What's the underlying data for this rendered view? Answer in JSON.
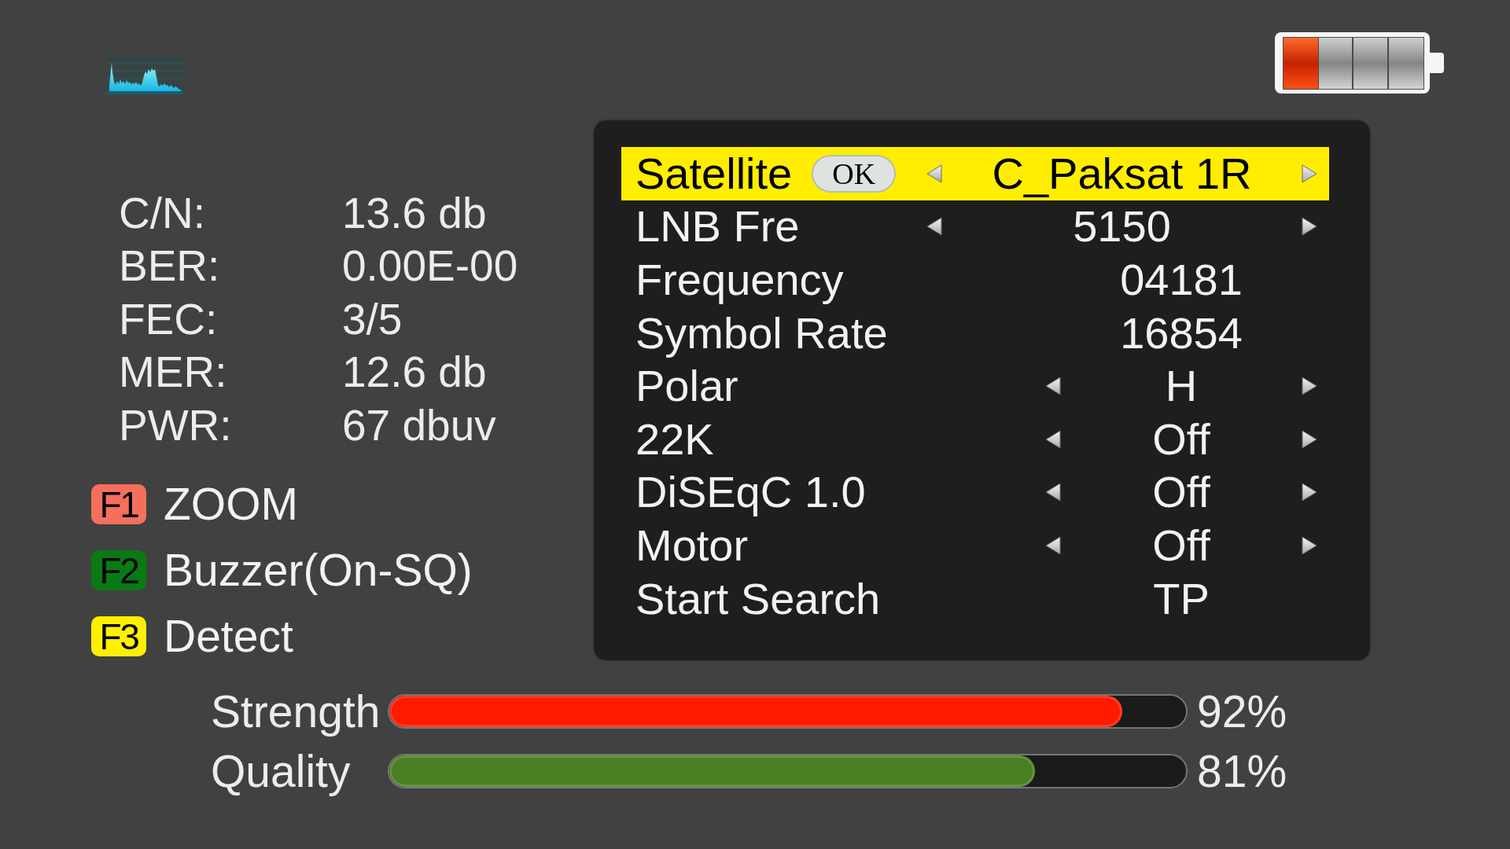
{
  "stats": [
    {
      "label": "C/N:",
      "value": "13.6 db"
    },
    {
      "label": "BER:",
      "value": "0.00E-00"
    },
    {
      "label": "FEC:",
      "value": "3/5"
    },
    {
      "label": "MER:",
      "value": "12.6 db"
    },
    {
      "label": "PWR:",
      "value": "67 dbuv"
    }
  ],
  "function_keys": [
    {
      "key": "F1",
      "label": "ZOOM",
      "color": "#f4705c"
    },
    {
      "key": "F2",
      "label": "Buzzer(On-SQ)",
      "color": "#0a7a14"
    },
    {
      "key": "F3",
      "label": "Detect",
      "color": "#fff000"
    }
  ],
  "menu": {
    "rows": [
      {
        "label": "Satellite",
        "ok_key": "OK",
        "value": "C_Paksat 1R",
        "kind": "list",
        "selected": true
      },
      {
        "label": "LNB Fre",
        "value": "5150",
        "kind": "list",
        "selected": false
      },
      {
        "label": "Frequency",
        "value": "04181",
        "kind": "value",
        "selected": false
      },
      {
        "label": "Symbol Rate",
        "value": "16854",
        "kind": "value",
        "selected": false
      },
      {
        "label": "Polar",
        "value": "H",
        "kind": "option",
        "selected": false
      },
      {
        "label": "22K",
        "value": "Off",
        "kind": "option",
        "selected": false
      },
      {
        "label": "DiSEqC 1.0",
        "value": "Off",
        "kind": "option",
        "selected": false
      },
      {
        "label": "Motor",
        "value": "Off",
        "kind": "option",
        "selected": false
      },
      {
        "label": "Start Search",
        "value": "TP",
        "kind": "value",
        "selected": false
      }
    ]
  },
  "meters": [
    {
      "label": "Strength",
      "level": 0.92,
      "reading": "92%",
      "color": "#ff1a00"
    },
    {
      "label": "Quality",
      "level": 0.81,
      "reading": "81%",
      "color": "#4a8023"
    }
  ]
}
